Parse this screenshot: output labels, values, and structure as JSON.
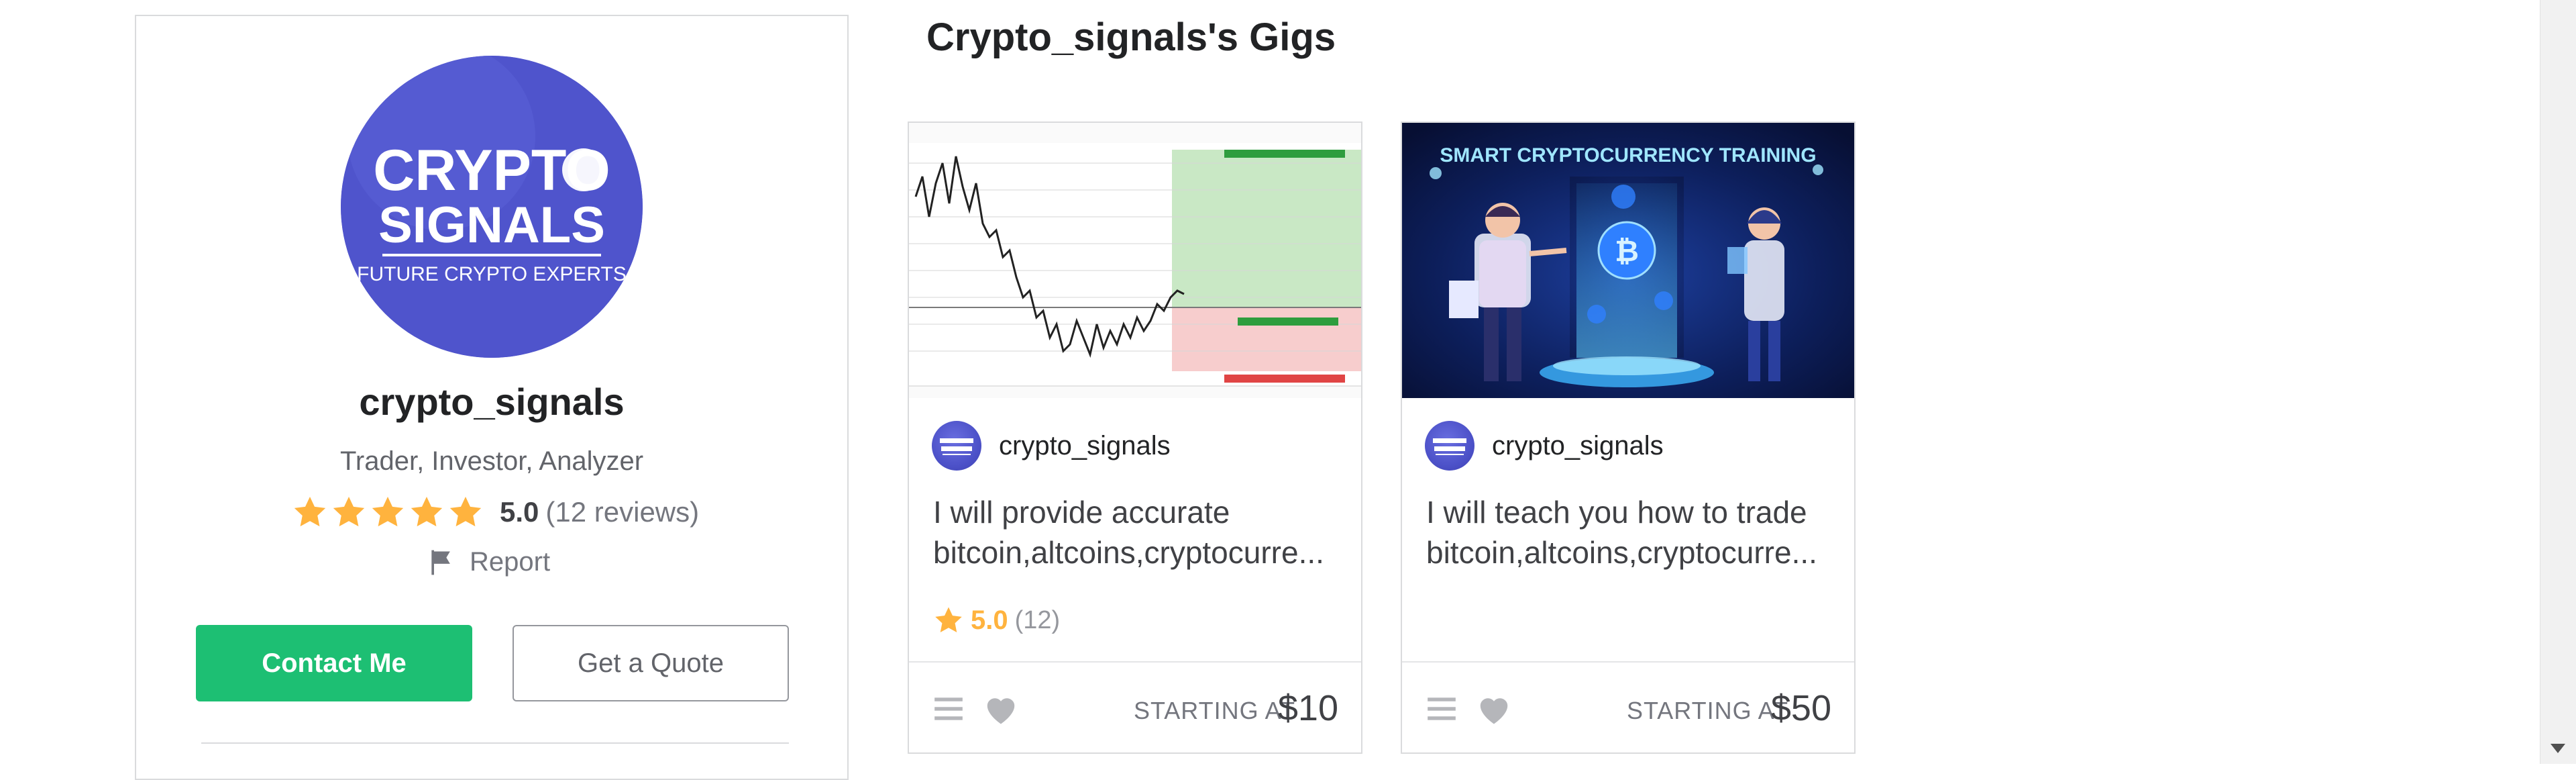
{
  "profile": {
    "avatar_text": [
      "CRYPTO",
      "SIGNALS",
      "FUTURE CRYPTO EXPERTS"
    ],
    "username": "crypto_signals",
    "tagline": "Trader, Investor, Analyzer",
    "rating": "5.0",
    "reviews": "(12 reviews)",
    "stars": 5,
    "report_label": "Report",
    "contact_label": "Contact Me",
    "quote_label": "Get a Quote"
  },
  "gigs_title": "Crypto_signals's Gigs",
  "gigs": [
    {
      "seller": "crypto_signals",
      "title_line1": "I will provide accurate",
      "title_line2": "bitcoin,altcoins,cryptocurre...",
      "rating": "5.0",
      "rating_count": "(12)",
      "starting_label": "STARTING AT",
      "price": "$10",
      "thumb": "trading-chart"
    },
    {
      "seller": "crypto_signals",
      "title_line1": "I will teach you how to trade",
      "title_line2": "bitcoin,altcoins,cryptocurre...",
      "starting_label": "STARTING AT",
      "price": "$50",
      "thumb_title": "SMART CRYPTOCURRENCY TRAINING"
    }
  ],
  "colors": {
    "accent_green": "#1dbf73",
    "star_yellow": "#ffb33e",
    "avatar_blue": "#4d52c9"
  }
}
